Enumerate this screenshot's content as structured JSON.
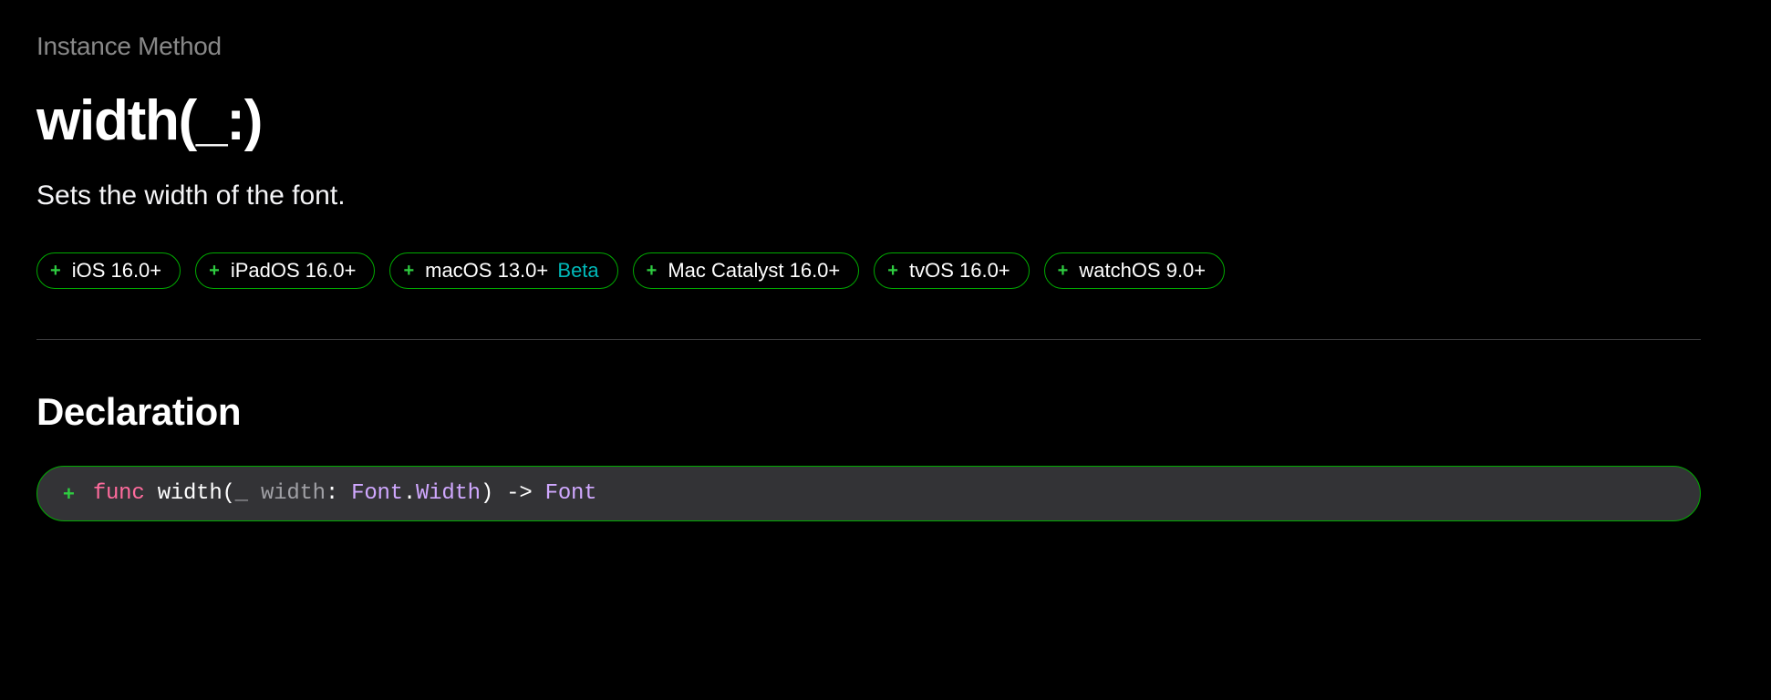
{
  "eyebrow": "Instance Method",
  "title": "width(_:)",
  "description": "Sets the width of the font.",
  "platforms": [
    {
      "name": "iOS 16.0+",
      "beta": ""
    },
    {
      "name": "iPadOS 16.0+",
      "beta": ""
    },
    {
      "name": "macOS 13.0+",
      "beta": "Beta"
    },
    {
      "name": "Mac Catalyst 16.0+",
      "beta": ""
    },
    {
      "name": "tvOS 16.0+",
      "beta": ""
    },
    {
      "name": "watchOS 9.0+",
      "beta": ""
    }
  ],
  "section_heading": "Declaration",
  "code": {
    "keyword": "func",
    "name": "width",
    "open_paren": "(",
    "underscore": "_",
    "param_name": "width",
    "colon": ":",
    "type1a": "Font",
    "dot": ".",
    "type1b": "Width",
    "close_paren": ")",
    "arrow": "->",
    "return_type": "Font"
  }
}
